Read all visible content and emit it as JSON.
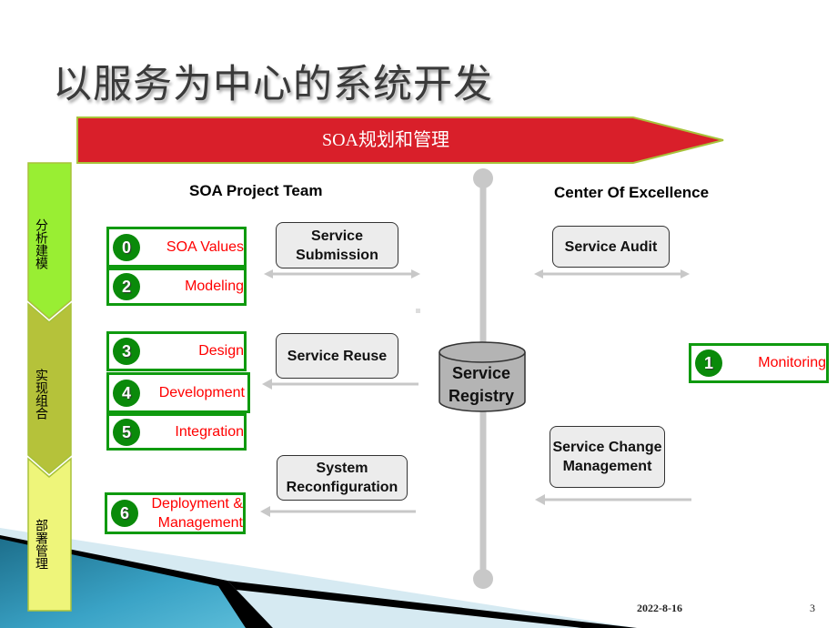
{
  "slide": {
    "title": "以服务为中心的系统开发",
    "banner": "SOA规划和管理",
    "footer": {
      "date": "2022-8-16",
      "page": "3"
    }
  },
  "phases": [
    {
      "label": "分析建模",
      "color": "#99ee33"
    },
    {
      "label": "实现组合",
      "color": "#b5c23a"
    },
    {
      "label": "部署管理",
      "color": "#eef57a"
    }
  ],
  "columns": {
    "left": "SOA Project Team",
    "right": "Center Of Excellence"
  },
  "items": [
    {
      "num": "0",
      "label": "SOA Values"
    },
    {
      "num": "2",
      "label": "Modeling"
    },
    {
      "num": "3",
      "label": "Design"
    },
    {
      "num": "4",
      "label": "Development"
    },
    {
      "num": "5",
      "label": "Integration"
    },
    {
      "num": "6",
      "label_line1": "Deployment &",
      "label_line2": "Management"
    },
    {
      "num": "1",
      "label": "Monitoring"
    }
  ],
  "processes": {
    "submission": "Service Submission",
    "reuse": "Service Reuse",
    "reconfiguration": "System Reconfiguration",
    "audit": "Service Audit",
    "change": "Service Change Management"
  },
  "registry": {
    "line1": "Service",
    "line2": "Registry"
  },
  "colors": {
    "banner_red": "#d91f2a",
    "item_green": "#0f9a0f",
    "item_text_red": "#ff0000",
    "arrow_gray": "#c8c8c8"
  }
}
